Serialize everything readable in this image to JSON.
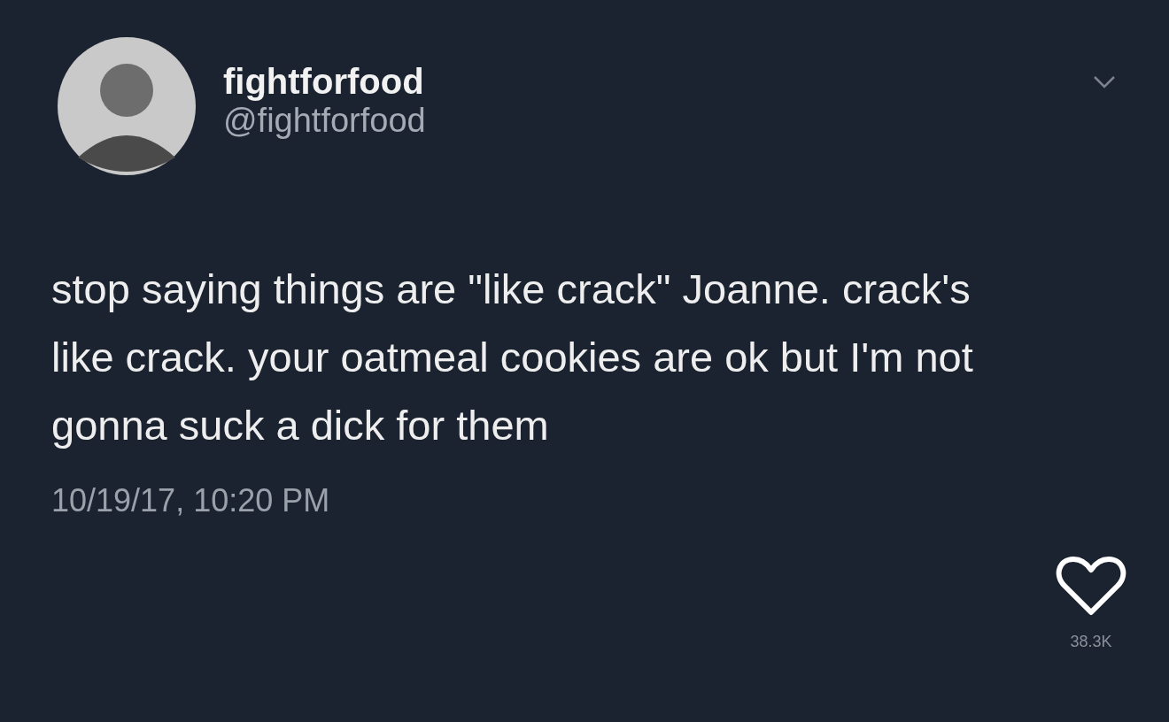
{
  "author": {
    "name": "fightforfood",
    "handle": "@fightforfood"
  },
  "tweet": {
    "text": "stop saying things are \"like crack\" Joanne. crack's like crack. your oatmeal cookies are ok but I'm not gonna suck a dick for them",
    "timestamp": "10/19/17, 10:20 PM"
  },
  "likes": {
    "count": "38.3K",
    "liked": false
  }
}
